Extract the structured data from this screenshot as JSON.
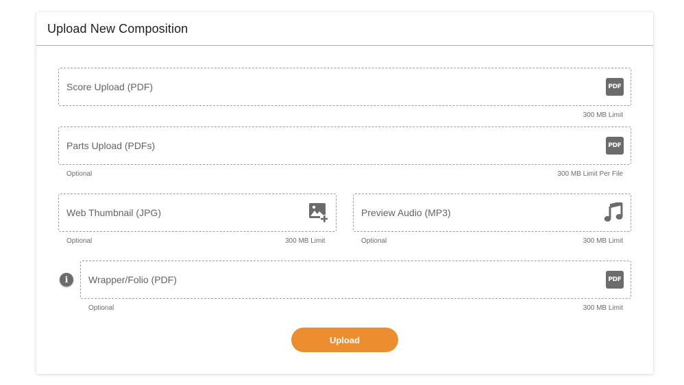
{
  "card": {
    "title": "Upload New Composition"
  },
  "fields": {
    "score": {
      "label": "Score Upload (PDF)",
      "icon": "pdf-icon",
      "limit": "300 MB Limit"
    },
    "parts": {
      "label": "Parts Upload (PDFs)",
      "icon": "pdf-icon",
      "optional": "Optional",
      "limit": "300 MB Limit Per File"
    },
    "thumb": {
      "label": "Web Thumbnail (JPG)",
      "icon": "add-image-icon",
      "optional": "Optional",
      "limit": "300 MB Limit"
    },
    "audio": {
      "label": "Preview Audio (MP3)",
      "icon": "music-note-icon",
      "optional": "Optional",
      "limit": "300 MB Limit"
    },
    "wrapper": {
      "label": "Wrapper/Folio (PDF)",
      "icon": "pdf-icon",
      "optional": "Optional",
      "limit": "300 MB Limit"
    }
  },
  "icons": {
    "pdf_text": "PDF",
    "info_text": "i"
  },
  "upload_button": {
    "label": "Upload"
  },
  "colors": {
    "accent": "#ec8e2f",
    "icon_gray": "#6b6b6b",
    "border": "#9c9c9c"
  }
}
